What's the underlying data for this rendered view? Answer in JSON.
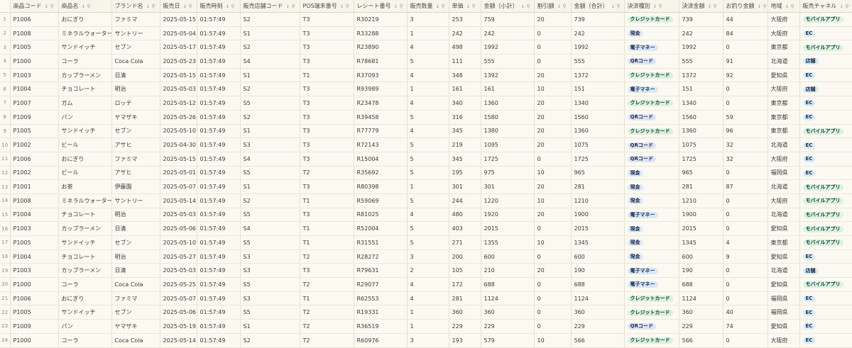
{
  "columns": [
    {
      "label": "商品コード"
    },
    {
      "label": "商品名"
    },
    {
      "label": "ブランド名"
    },
    {
      "label": "販売日"
    },
    {
      "label": "販売時刻"
    },
    {
      "label": "販売店舗コード"
    },
    {
      "label": "POS端末番号"
    },
    {
      "label": "レシート番号"
    },
    {
      "label": "販売数量"
    },
    {
      "label": "単価"
    },
    {
      "label": "金額（小計）"
    },
    {
      "label": "割引額"
    },
    {
      "label": "金額（合計）"
    },
    {
      "label": "決済種別"
    },
    {
      "label": "決済金額"
    },
    {
      "label": "お釣り金額"
    },
    {
      "label": "地域"
    },
    {
      "label": "販売チャネル"
    }
  ],
  "header_controls": {
    "sort": "↓",
    "filter": "⚲"
  },
  "badge_colors": {
    "credit": "#d8f3dc",
    "cash": "#dbeafb",
    "emoney": "#d7e9fb",
    "qr": "#dde3f7",
    "ec": "#d4ecfa",
    "mobile": "#d6f5dd"
  },
  "rows": [
    {
      "n": "1",
      "c": [
        "P1006",
        "おにぎり",
        "ファミマ",
        "2025-05-15",
        "01:57:49",
        "S2",
        "T3",
        "R30219",
        "3",
        "253",
        "759",
        "20",
        "739",
        "クレジットカード",
        "739",
        "44",
        "大阪府",
        "モバイルアプリ"
      ]
    },
    {
      "n": "2",
      "c": [
        "P1008",
        "ミネラルウォーター",
        "サントリー",
        "2025-05-04",
        "01:57:49",
        "S1",
        "T3",
        "R33288",
        "1",
        "242",
        "242",
        "0",
        "242",
        "現金",
        "242",
        "84",
        "大阪府",
        "EC"
      ]
    },
    {
      "n": "3",
      "c": [
        "P1005",
        "サンドイッチ",
        "セブン",
        "2025-05-17",
        "01:57:49",
        "S2",
        "T3",
        "R23890",
        "4",
        "498",
        "1992",
        "0",
        "1992",
        "電子マネー",
        "1992",
        "0",
        "東京都",
        "モバイルアプリ"
      ]
    },
    {
      "n": "4",
      "c": [
        "P1000",
        "コーラ",
        "Coca Cola",
        "2025-05-23",
        "01:57:49",
        "S4",
        "T3",
        "R78681",
        "5",
        "111",
        "555",
        "0",
        "555",
        "QRコード",
        "555",
        "91",
        "北海道",
        "店舗"
      ]
    },
    {
      "n": "5",
      "c": [
        "P1003",
        "カップラーメン",
        "日清",
        "2025-05-15",
        "01:57:49",
        "S1",
        "T1",
        "R37093",
        "4",
        "348",
        "1392",
        "20",
        "1372",
        "クレジットカード",
        "1372",
        "92",
        "愛知県",
        "EC"
      ]
    },
    {
      "n": "6",
      "c": [
        "P1004",
        "チョコレート",
        "明治",
        "2025-05-03",
        "01:57:49",
        "S2",
        "T3",
        "R93989",
        "1",
        "161",
        "161",
        "10",
        "151",
        "電子マネー",
        "151",
        "0",
        "大阪府",
        "店舗"
      ]
    },
    {
      "n": "7",
      "c": [
        "P1007",
        "ガム",
        "ロッテ",
        "2025-05-12",
        "01:57:49",
        "S5",
        "T3",
        "R23478",
        "4",
        "340",
        "1360",
        "20",
        "1340",
        "クレジットカード",
        "1340",
        "0",
        "東京都",
        "EC"
      ]
    },
    {
      "n": "8",
      "c": [
        "P1009",
        "パン",
        "ヤマザキ",
        "2025-05-26",
        "01:57:49",
        "S2",
        "T3",
        "R39458",
        "5",
        "316",
        "1580",
        "20",
        "1560",
        "QRコード",
        "1560",
        "59",
        "東京都",
        "EC"
      ]
    },
    {
      "n": "9",
      "c": [
        "P1005",
        "サンドイッチ",
        "セブン",
        "2025-05-10",
        "01:57:49",
        "S1",
        "T3",
        "R77779",
        "4",
        "345",
        "1380",
        "20",
        "1360",
        "クレジットカード",
        "1360",
        "96",
        "東京都",
        "モバイルアプリ"
      ]
    },
    {
      "n": "10",
      "c": [
        "P1002",
        "ビール",
        "アサヒ",
        "2025-04-30",
        "01:57:49",
        "S3",
        "T3",
        "R72143",
        "5",
        "219",
        "1095",
        "20",
        "1075",
        "QRコード",
        "1075",
        "32",
        "北海道",
        "EC"
      ]
    },
    {
      "n": "11",
      "c": [
        "P1006",
        "おにぎり",
        "ファミマ",
        "2025-05-15",
        "01:57:49",
        "S4",
        "T3",
        "R15004",
        "5",
        "345",
        "1725",
        "0",
        "1725",
        "QRコード",
        "1725",
        "32",
        "大阪府",
        "EC"
      ]
    },
    {
      "n": "12",
      "c": [
        "P1002",
        "ビール",
        "アサヒ",
        "2025-05-01",
        "01:57:49",
        "S5",
        "T2",
        "R35692",
        "5",
        "195",
        "975",
        "10",
        "965",
        "現金",
        "965",
        "0",
        "福岡県",
        "EC"
      ]
    },
    {
      "n": "13",
      "c": [
        "P1001",
        "お茶",
        "伊藤園",
        "2025-05-07",
        "01:57:49",
        "S1",
        "T3",
        "R80398",
        "1",
        "301",
        "301",
        "20",
        "281",
        "現金",
        "281",
        "87",
        "北海道",
        "モバイルアプリ"
      ]
    },
    {
      "n": "14",
      "c": [
        "P1008",
        "ミネラルウォーター",
        "サントリー",
        "2025-05-14",
        "01:57:49",
        "S2",
        "T1",
        "R59069",
        "5",
        "244",
        "1220",
        "10",
        "1210",
        "現金",
        "1210",
        "0",
        "大阪府",
        "モバイルアプリ"
      ]
    },
    {
      "n": "15",
      "c": [
        "P1004",
        "チョコレート",
        "明治",
        "2025-05-03",
        "01:57:49",
        "S5",
        "T3",
        "R81025",
        "4",
        "480",
        "1920",
        "20",
        "1900",
        "電子マネー",
        "1900",
        "0",
        "北海道",
        "モバイルアプリ"
      ]
    },
    {
      "n": "16",
      "c": [
        "P1003",
        "カップラーメン",
        "日清",
        "2025-05-06",
        "01:57:49",
        "S4",
        "T1",
        "R52004",
        "5",
        "403",
        "2015",
        "0",
        "2015",
        "現金",
        "2015",
        "0",
        "愛知県",
        "モバイルアプリ"
      ]
    },
    {
      "n": "17",
      "c": [
        "P1005",
        "サンドイッチ",
        "セブン",
        "2025-05-10",
        "01:57:49",
        "S5",
        "T1",
        "R31551",
        "5",
        "271",
        "1355",
        "10",
        "1345",
        "現金",
        "1345",
        "4",
        "東京都",
        "モバイルアプリ"
      ]
    },
    {
      "n": "18",
      "c": [
        "P1004",
        "チョコレート",
        "明治",
        "2025-05-27",
        "01:57:49",
        "S3",
        "T2",
        "R28272",
        "3",
        "200",
        "600",
        "0",
        "600",
        "現金",
        "600",
        "9",
        "愛知県",
        "EC"
      ]
    },
    {
      "n": "19",
      "c": [
        "P1003",
        "カップラーメン",
        "日清",
        "2025-05-03",
        "01:57:49",
        "S3",
        "T3",
        "R79631",
        "2",
        "105",
        "210",
        "20",
        "190",
        "電子マネー",
        "190",
        "0",
        "北海道",
        "店舗"
      ]
    },
    {
      "n": "20",
      "c": [
        "P1000",
        "コーラ",
        "Coca Cola",
        "2025-05-25",
        "01:57:49",
        "S5",
        "T2",
        "R29077",
        "4",
        "172",
        "688",
        "0",
        "688",
        "電子マネー",
        "688",
        "0",
        "愛知県",
        "モバイルアプリ"
      ]
    },
    {
      "n": "21",
      "c": [
        "P1006",
        "おにぎり",
        "ファミマ",
        "2025-05-07",
        "01:57:49",
        "S3",
        "T1",
        "R62553",
        "4",
        "281",
        "1124",
        "0",
        "1124",
        "クレジットカード",
        "1124",
        "0",
        "福岡県",
        "EC"
      ]
    },
    {
      "n": "22",
      "c": [
        "P1005",
        "サンドイッチ",
        "セブン",
        "2025-05-06",
        "01:57:49",
        "S5",
        "T2",
        "R19331",
        "1",
        "360",
        "360",
        "0",
        "360",
        "クレジットカード",
        "360",
        "40",
        "福岡県",
        "EC"
      ]
    },
    {
      "n": "23",
      "c": [
        "P1009",
        "パン",
        "ヤマザキ",
        "2025-05-19",
        "01:57:49",
        "S1",
        "T2",
        "R36519",
        "1",
        "229",
        "229",
        "0",
        "229",
        "QRコード",
        "229",
        "74",
        "愛知県",
        "EC"
      ]
    },
    {
      "n": "24",
      "c": [
        "P1000",
        "コーラ",
        "Coca Cola",
        "2025-05-14",
        "01:57:49",
        "S2",
        "T2",
        "R60976",
        "3",
        "193",
        "579",
        "10",
        "566",
        "クレジットカード",
        "566",
        "0",
        "大阪府",
        "EC"
      ]
    }
  ]
}
